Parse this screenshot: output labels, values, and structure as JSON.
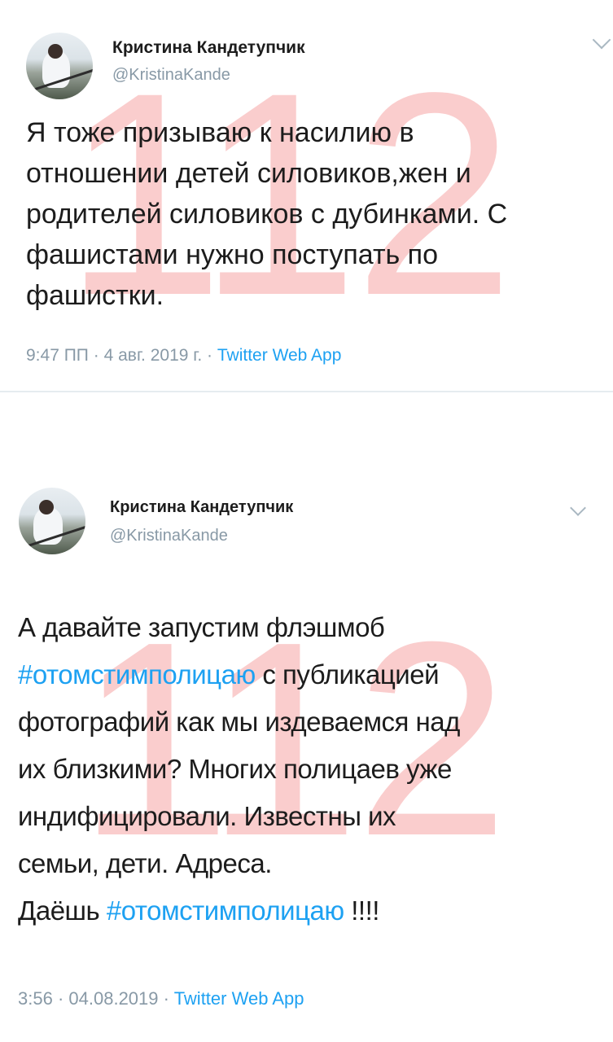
{
  "tweets": [
    {
      "author_name": "Кристина Кандетупчик",
      "author_handle": "@KristinaKande",
      "text": "Я тоже призываю к насилию в\nотношении детей силовиков,жен и\nродителей силовиков с дубинками. С\nфашистами нужно поступать по\nфашистки.",
      "time": "9:47 ПП",
      "date": "4 авг. 2019 г.",
      "separator": "·",
      "source": "Twitter Web App",
      "watermark": "112",
      "icons": {
        "avatar": "profile-avatar",
        "menu": "chevron-down-icon"
      }
    },
    {
      "author_name": "Кристина Кандетупчик",
      "author_handle": "@KristinaKande",
      "text_parts": {
        "line1": "А давайте запустим флэшмоб",
        "hashtag1": "#отомстимполицаю",
        "after_hashtag1": " с публикацией",
        "rest": "фотографий как мы издеваемся над\nих близкими? Многих полицаев уже\nиндифицировали. Известны их\nсемьи, дети. Адреса.",
        "before_hashtag2": "Даёшь ",
        "hashtag2": "#отомстимполицаю",
        "after_hashtag2": " !!!!"
      },
      "time": "3:56",
      "date": "04.08.2019",
      "separator": "·",
      "source": "Twitter Web App",
      "watermark": "112",
      "icons": {
        "avatar": "profile-avatar",
        "menu": "chevron-down-icon"
      }
    }
  ],
  "colors": {
    "link": "#1da1f2",
    "muted": "#8899a6",
    "text": "#1c1c1c",
    "watermark": "#ec3c3c",
    "divider": "#e6ecf0"
  }
}
